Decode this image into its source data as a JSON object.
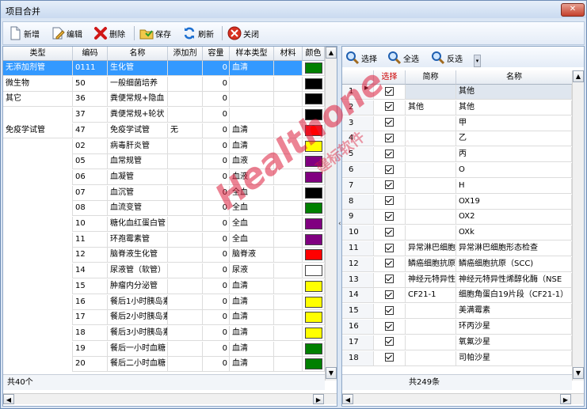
{
  "window": {
    "title": "项目合并",
    "close_label": "✕"
  },
  "toolbar": {
    "new": "新增",
    "edit": "编辑",
    "delete": "删除",
    "save": "保存",
    "refresh": "刷新",
    "close": "关闭"
  },
  "left": {
    "headers": [
      "类型",
      "编码",
      "名称",
      "添加剂",
      "容量",
      "样本类型",
      "材料",
      "颜色"
    ],
    "rows": [
      {
        "type": "无添加剂管",
        "code": "0111",
        "name": "生化管",
        "additive": "",
        "cap": "0",
        "sample": "血清",
        "color": "#008000",
        "selected": true
      },
      {
        "type": "微生物",
        "code": "50",
        "name": "一般细菌培养",
        "additive": "",
        "cap": "0",
        "sample": "",
        "color": "#000000"
      },
      {
        "type": "其它",
        "code": "36",
        "name": "粪便常规+隐血",
        "additive": "",
        "cap": "0",
        "sample": "",
        "color": "#000000"
      },
      {
        "type": "",
        "code": "37",
        "name": "粪便常规+轮状",
        "additive": "",
        "cap": "0",
        "sample": "",
        "color": "#000000"
      },
      {
        "type": "免疫学试管",
        "code": "47",
        "name": "免疫学试管",
        "additive": "无",
        "cap": "0",
        "sample": "血清",
        "color": "#ff0000"
      },
      {
        "type": "",
        "code": "02",
        "name": "病毒肝炎管",
        "additive": "",
        "cap": "0",
        "sample": "血清",
        "color": "#ffff00"
      },
      {
        "type": "",
        "code": "05",
        "name": "血常规管",
        "additive": "",
        "cap": "0",
        "sample": "血液",
        "color": "#800080"
      },
      {
        "type": "",
        "code": "06",
        "name": "血凝管",
        "additive": "",
        "cap": "0",
        "sample": "血液",
        "color": "#800080"
      },
      {
        "type": "",
        "code": "07",
        "name": "血沉管",
        "additive": "",
        "cap": "0",
        "sample": "全血",
        "color": "#000000"
      },
      {
        "type": "",
        "code": "08",
        "name": "血流变管",
        "additive": "",
        "cap": "0",
        "sample": "全血",
        "color": "#008000"
      },
      {
        "type": "",
        "code": "10",
        "name": "糖化血红蛋白管",
        "additive": "",
        "cap": "0",
        "sample": "全血",
        "color": "#800080"
      },
      {
        "type": "",
        "code": "11",
        "name": "环孢霉素管",
        "additive": "",
        "cap": "0",
        "sample": "全血",
        "color": "#800080"
      },
      {
        "type": "",
        "code": "12",
        "name": "脑脊液生化管",
        "additive": "",
        "cap": "0",
        "sample": "脑脊液",
        "color": "#ff0000"
      },
      {
        "type": "",
        "code": "14",
        "name": "尿液管（软管）",
        "additive": "",
        "cap": "0",
        "sample": "尿液",
        "color": "#ffffff"
      },
      {
        "type": "",
        "code": "15",
        "name": "肿瘤内分泌管",
        "additive": "",
        "cap": "0",
        "sample": "血清",
        "color": "#ffff00"
      },
      {
        "type": "",
        "code": "16",
        "name": "餐后1小时胰岛素",
        "additive": "",
        "cap": "0",
        "sample": "血清",
        "color": "#ffff00"
      },
      {
        "type": "",
        "code": "17",
        "name": "餐后2小时胰岛素",
        "additive": "",
        "cap": "0",
        "sample": "血清",
        "color": "#ffff00"
      },
      {
        "type": "",
        "code": "18",
        "name": "餐后3小时胰岛素",
        "additive": "",
        "cap": "0",
        "sample": "血清",
        "color": "#ffff00"
      },
      {
        "type": "",
        "code": "19",
        "name": "餐后一小时血糖",
        "additive": "",
        "cap": "0",
        "sample": "血清",
        "color": "#008000"
      },
      {
        "type": "",
        "code": "20",
        "name": "餐后二小时血糖",
        "additive": "",
        "cap": "0",
        "sample": "血清",
        "color": "#008000"
      }
    ],
    "footer": "共40个"
  },
  "right": {
    "toolbar": {
      "select": "选择",
      "select_all": "全选",
      "invert": "反选"
    },
    "headers": [
      "",
      "选择",
      "简称",
      "名称"
    ],
    "rows": [
      {
        "no": "1",
        "short": "",
        "name": "其他",
        "current": true
      },
      {
        "no": "2",
        "short": "其他",
        "name": "其他"
      },
      {
        "no": "3",
        "short": "",
        "name": "甲"
      },
      {
        "no": "4",
        "short": "",
        "name": "乙"
      },
      {
        "no": "5",
        "short": "",
        "name": "丙"
      },
      {
        "no": "6",
        "short": "",
        "name": "O"
      },
      {
        "no": "7",
        "short": "",
        "name": "H"
      },
      {
        "no": "8",
        "short": "",
        "name": "OX19"
      },
      {
        "no": "9",
        "short": "",
        "name": "OX2"
      },
      {
        "no": "10",
        "short": "",
        "name": "OXk"
      },
      {
        "no": "11",
        "short": "异常淋巴细胞形态检查",
        "name": "异常淋巴细胞形态检查"
      },
      {
        "no": "12",
        "short": "鳞癌细胞抗原",
        "name": "鳞癌细胞抗原（SCC)"
      },
      {
        "no": "13",
        "short": "神经元特异性烯醇化酶",
        "name": "神经元特异性烯醇化酶（NSE"
      },
      {
        "no": "14",
        "short": "CF21-1",
        "name": "细胞角蛋白19片段（CF21-1）"
      },
      {
        "no": "15",
        "short": "",
        "name": "美满霉素"
      },
      {
        "no": "16",
        "short": "",
        "name": "环丙沙星"
      },
      {
        "no": "17",
        "short": "",
        "name": "氧氟沙星"
      },
      {
        "no": "18",
        "short": "",
        "name": "司帕沙星"
      }
    ],
    "footer": "共249条"
  },
  "watermark": {
    "main": "Healthone",
    "sub": "建标软件"
  },
  "colors": {
    "selection": "#3399ff",
    "header_red": "#cc0000"
  }
}
